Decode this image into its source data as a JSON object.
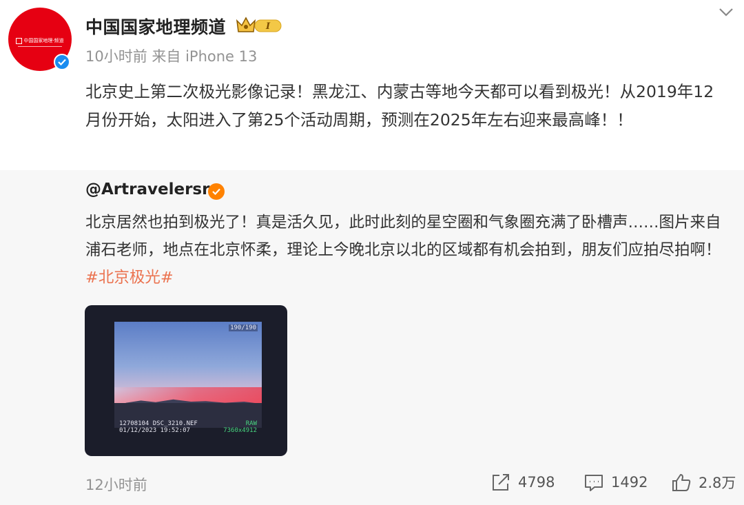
{
  "post": {
    "username": "中国国家地理频道",
    "vip_badge_text": "I",
    "meta": "10小时前 来自 iPhone 13",
    "text": "北京史上第二次极光影像记录！黑龙江、内蒙古等地今天都可以看到极光！从2019年12月份开始，太阳进入了第25个活动周期，预测在2025年左右迎来最高峰！！",
    "avatar": {
      "logo_text": "中国国家地理·频道",
      "color": "#e60012"
    }
  },
  "repost": {
    "author": "@Artravelersr",
    "text": "北京居然也拍到极光了！真是活久见，此时此刻的星空圈和气象圈充满了卧槽声……图片来自浦石老师，地点在北京怀柔，理论上今晚北京以北的区域都有机会拍到，朋友们应拍尽拍啊！",
    "hashtag": "#北京极光#",
    "time": "12小时前",
    "image": {
      "counter": "190/190",
      "file_line": "12708104 DSC_3210.NEF",
      "date_line": "01/12/2023 19:52:07",
      "raw_label": "RAW",
      "size_label": "7360x4912"
    },
    "actions": {
      "share_count": "4798",
      "comment_count": "1492",
      "like_count": "2.8万"
    }
  },
  "colors": {
    "hashtag": "#eb7350",
    "verified_blue": "#1a8cf0",
    "verified_orange": "#ff8200"
  }
}
